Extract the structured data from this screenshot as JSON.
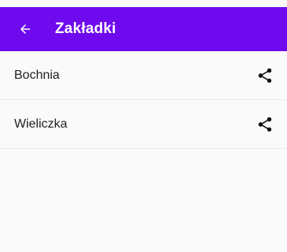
{
  "appbar": {
    "title": "Zakładki",
    "back_icon": "arrow-left-icon",
    "color": "#6f0aee"
  },
  "bookmarks": [
    {
      "label": "Bochnia",
      "action_icon": "share-icon"
    },
    {
      "label": "Wieliczka",
      "action_icon": "share-icon"
    }
  ]
}
